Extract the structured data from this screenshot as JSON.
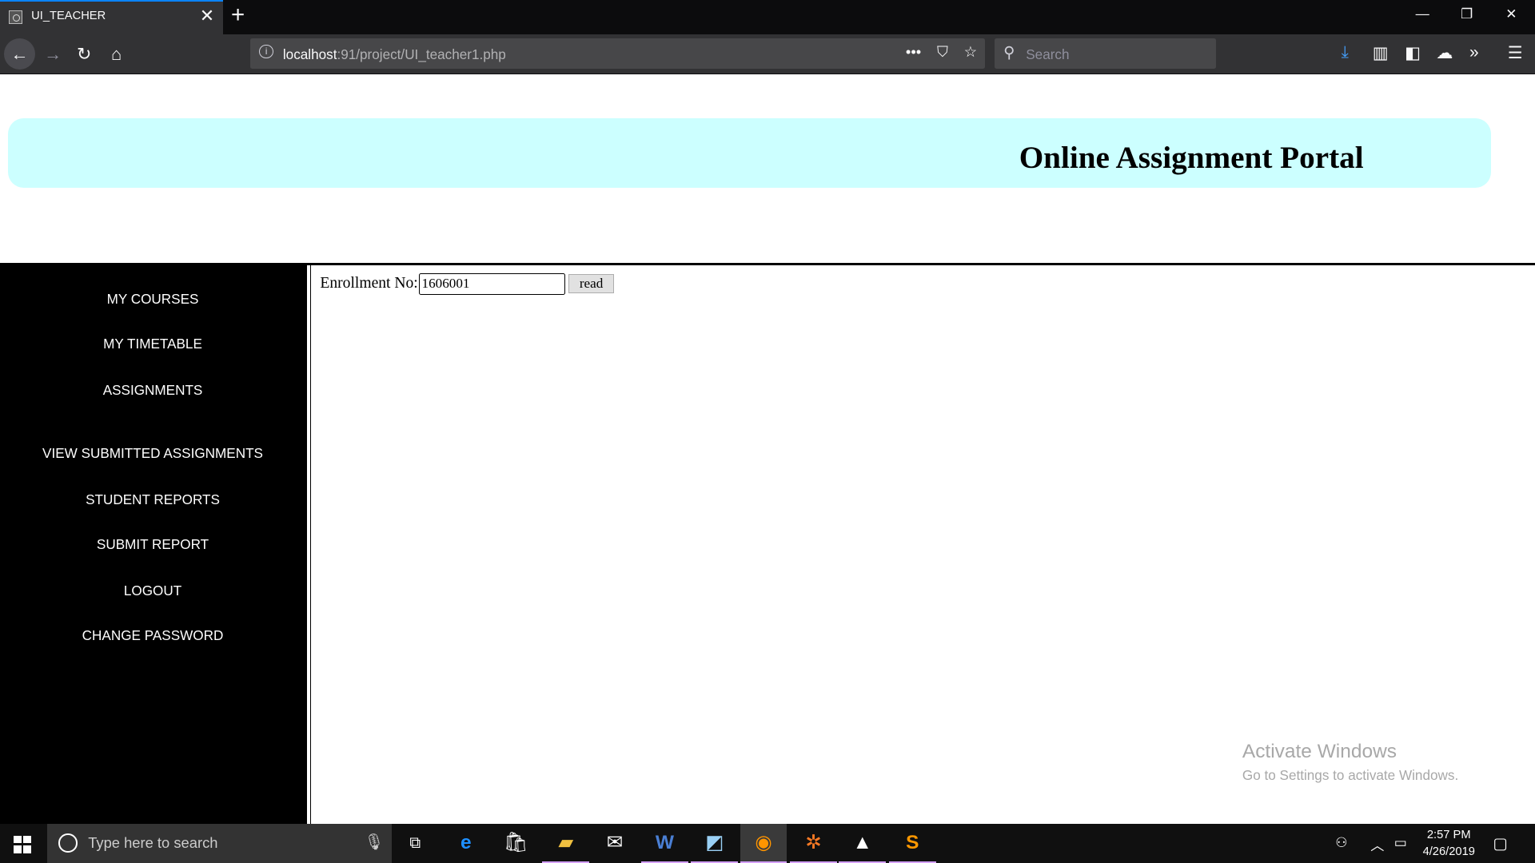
{
  "browser": {
    "tab_title": "UI_TEACHER",
    "url_host": "localhost",
    "url_path": ":91/project/UI_teacher1.php",
    "search_placeholder": "Search"
  },
  "page": {
    "banner_title": "Online Assignment Portal",
    "sidebar_items": [
      "MY COURSES",
      "MY TIMETABLE",
      "ASSIGNMENTS",
      "VIEW SUBMITTED ASSIGNMENTS",
      "STUDENT REPORTS",
      "SUBMIT REPORT",
      "LOGOUT",
      "CHANGE PASSWORD"
    ],
    "enrollment_label": "Enrollment No:",
    "enrollment_value": "1606001",
    "read_button": "read"
  },
  "watermark": {
    "line1": "Activate Windows",
    "line2": "Go to Settings to activate Windows."
  },
  "taskbar": {
    "search_placeholder": "Type here to search",
    "time": "2:57 PM",
    "date": "4/26/2019"
  },
  "colors": {
    "banner_bg": "#ccffff",
    "sidebar_bg": "#000000",
    "browser_chrome": "#323234",
    "accent": "#0a84ff"
  }
}
